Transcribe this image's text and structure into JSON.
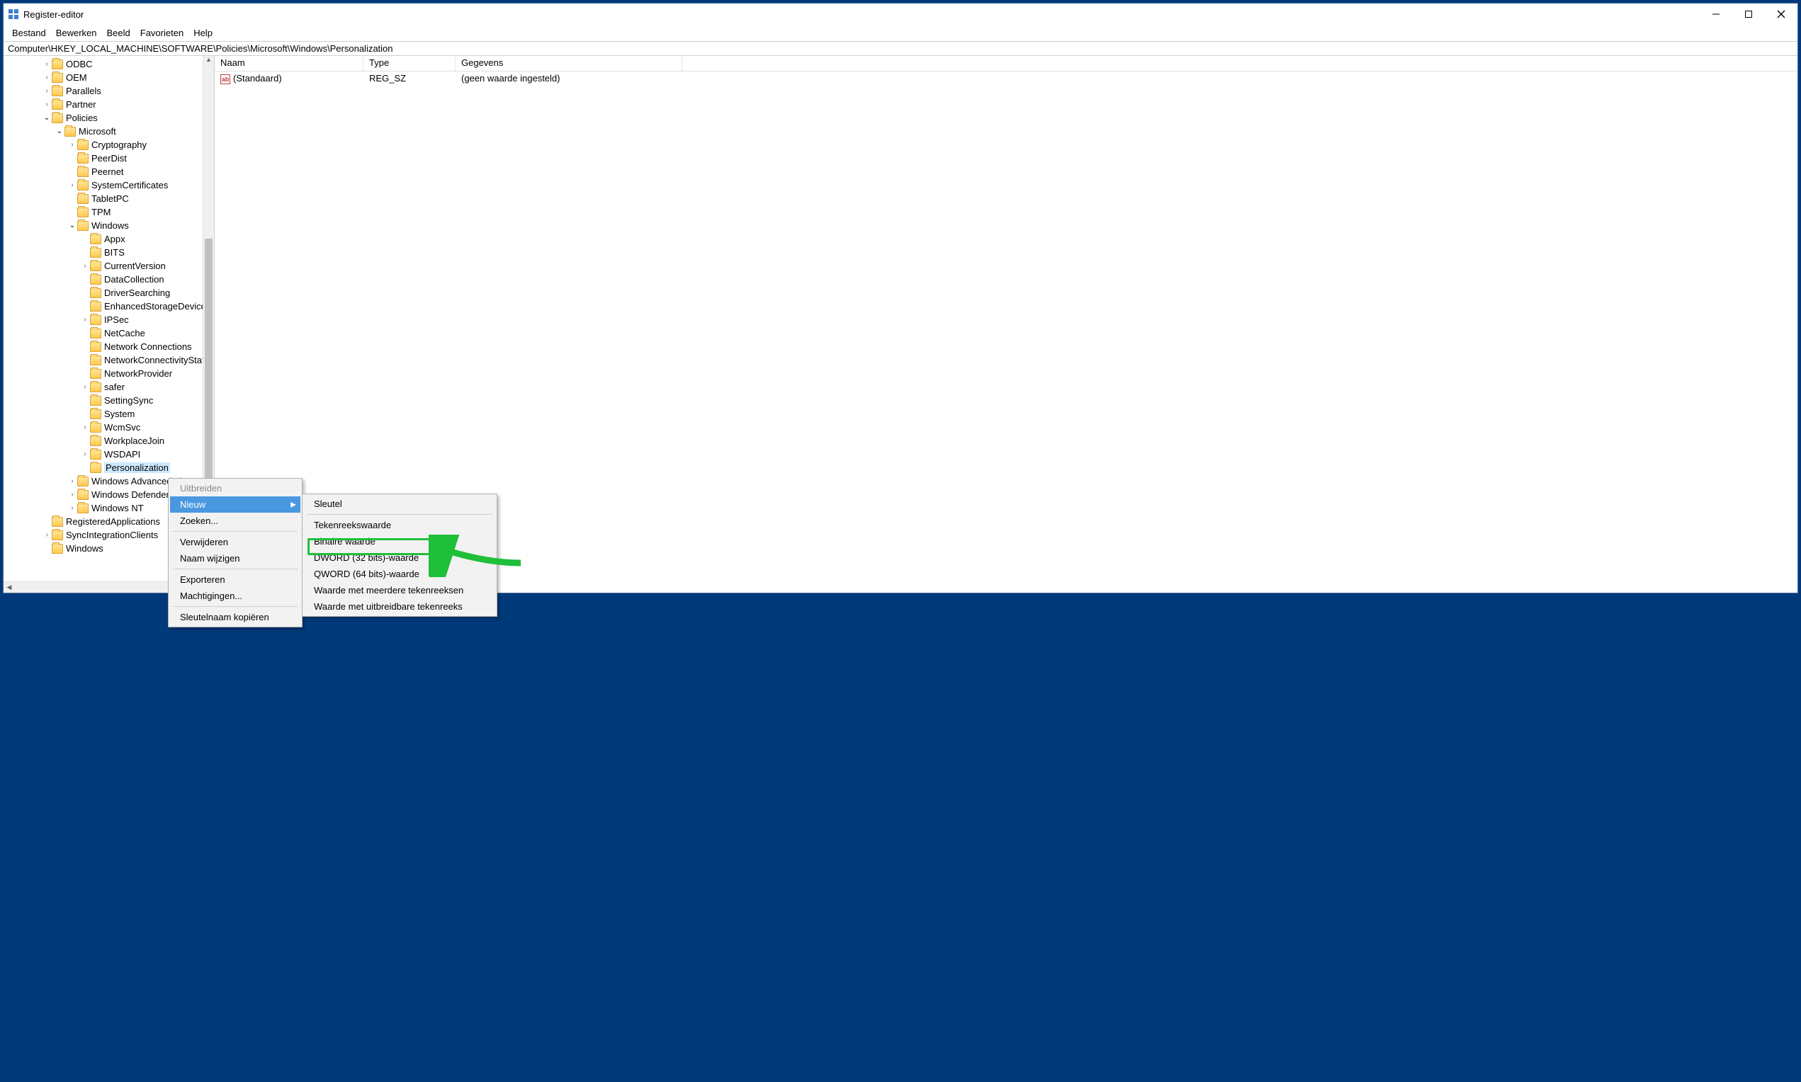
{
  "window": {
    "title": "Register-editor"
  },
  "menubar": {
    "items": [
      "Bestand",
      "Bewerken",
      "Beeld",
      "Favorieten",
      "Help"
    ]
  },
  "addressbar": {
    "path": "Computer\\HKEY_LOCAL_MACHINE\\SOFTWARE\\Policies\\Microsoft\\Windows\\Personalization"
  },
  "tree": {
    "items": [
      {
        "indent": 3,
        "exp": ">",
        "label": "ODBC"
      },
      {
        "indent": 3,
        "exp": ">",
        "label": "OEM"
      },
      {
        "indent": 3,
        "exp": ">",
        "label": "Parallels"
      },
      {
        "indent": 3,
        "exp": ">",
        "label": "Partner"
      },
      {
        "indent": 3,
        "exp": "v",
        "label": "Policies"
      },
      {
        "indent": 4,
        "exp": "v",
        "label": "Microsoft"
      },
      {
        "indent": 5,
        "exp": ">",
        "label": "Cryptography"
      },
      {
        "indent": 5,
        "exp": "",
        "label": "PeerDist"
      },
      {
        "indent": 5,
        "exp": "",
        "label": "Peernet"
      },
      {
        "indent": 5,
        "exp": ">",
        "label": "SystemCertificates"
      },
      {
        "indent": 5,
        "exp": "",
        "label": "TabletPC"
      },
      {
        "indent": 5,
        "exp": "",
        "label": "TPM"
      },
      {
        "indent": 5,
        "exp": "v",
        "label": "Windows"
      },
      {
        "indent": 6,
        "exp": "",
        "label": "Appx"
      },
      {
        "indent": 6,
        "exp": "",
        "label": "BITS"
      },
      {
        "indent": 6,
        "exp": ">",
        "label": "CurrentVersion"
      },
      {
        "indent": 6,
        "exp": "",
        "label": "DataCollection"
      },
      {
        "indent": 6,
        "exp": "",
        "label": "DriverSearching"
      },
      {
        "indent": 6,
        "exp": "",
        "label": "EnhancedStorageDevices"
      },
      {
        "indent": 6,
        "exp": ">",
        "label": "IPSec"
      },
      {
        "indent": 6,
        "exp": "",
        "label": "NetCache"
      },
      {
        "indent": 6,
        "exp": "",
        "label": "Network Connections"
      },
      {
        "indent": 6,
        "exp": "",
        "label": "NetworkConnectivityStatusIndicator"
      },
      {
        "indent": 6,
        "exp": "",
        "label": "NetworkProvider"
      },
      {
        "indent": 6,
        "exp": ">",
        "label": "safer"
      },
      {
        "indent": 6,
        "exp": "",
        "label": "SettingSync"
      },
      {
        "indent": 6,
        "exp": "",
        "label": "System"
      },
      {
        "indent": 6,
        "exp": ">",
        "label": "WcmSvc"
      },
      {
        "indent": 6,
        "exp": "",
        "label": "WorkplaceJoin"
      },
      {
        "indent": 6,
        "exp": ">",
        "label": "WSDAPI"
      },
      {
        "indent": 6,
        "exp": "",
        "label": "Personalization",
        "selected": true
      },
      {
        "indent": 5,
        "exp": ">",
        "label": "Windows Advanced Threat Protection"
      },
      {
        "indent": 5,
        "exp": ">",
        "label": "Windows Defender"
      },
      {
        "indent": 5,
        "exp": ">",
        "label": "Windows NT"
      },
      {
        "indent": 3,
        "exp": "",
        "label": "RegisteredApplications"
      },
      {
        "indent": 3,
        "exp": ">",
        "label": "SyncIntegrationClients"
      },
      {
        "indent": 3,
        "exp": "",
        "label": "Windows"
      }
    ]
  },
  "list": {
    "columns": [
      "Naam",
      "Type",
      "Gegevens"
    ],
    "rows": [
      {
        "name": "(Standaard)",
        "type": "REG_SZ",
        "data": "(geen waarde ingesteld)"
      }
    ]
  },
  "context_menu": {
    "items": [
      {
        "label": "Uitbreiden",
        "disabled": true
      },
      {
        "label": "Nieuw",
        "hover": true,
        "submenu": true
      },
      {
        "label": "Zoeken..."
      },
      {
        "sep": true
      },
      {
        "label": "Verwijderen"
      },
      {
        "label": "Naam wijzigen"
      },
      {
        "sep": true
      },
      {
        "label": "Exporteren"
      },
      {
        "label": "Machtigingen..."
      },
      {
        "sep": true
      },
      {
        "label": "Sleutelnaam kopiëren"
      }
    ]
  },
  "submenu": {
    "items": [
      {
        "label": "Sleutel"
      },
      {
        "sep": true
      },
      {
        "label": "Tekenreekswaarde"
      },
      {
        "label": "Binaire waarde"
      },
      {
        "label": "DWORD (32 bits)-waarde",
        "highlighted": true
      },
      {
        "label": "QWORD (64 bits)-waarde"
      },
      {
        "label": "Waarde met meerdere tekenreeksen"
      },
      {
        "label": "Waarde met uitbreidbare tekenreeks"
      }
    ]
  }
}
